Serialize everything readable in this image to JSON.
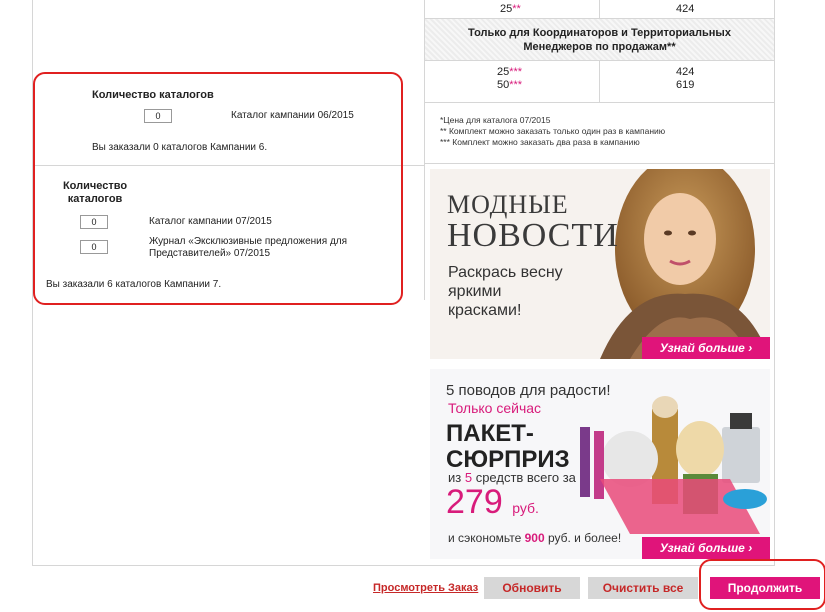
{
  "left_panel": {
    "section1": {
      "heading": "Количество каталогов",
      "qty_value": "0",
      "catalog_label": "Каталог кампании 06/2015",
      "ordered_text": "Вы заказали 0 каталогов Кампании 6."
    },
    "section2": {
      "heading_line1": "Количество",
      "heading_line2": "каталогов",
      "items": [
        {
          "qty": "0",
          "label": "Каталог кампании 07/2015"
        },
        {
          "qty": "0",
          "label_line1": "Журнал «Эксклюзивные предложения для",
          "label_line2": "Представителей» 07/2015"
        }
      ],
      "ordered_text": "Вы заказали 6 каталогов Кампании 7."
    }
  },
  "price_table": {
    "row_top": {
      "qty": "25",
      "stars": "**",
      "price": "424"
    },
    "coordinators_header_line1": "Только для Координаторов и Территориальных",
    "coordinators_header_line2": "Менеджеров по продажам**",
    "rows": [
      {
        "qty": "25",
        "stars": "***",
        "price": "424"
      },
      {
        "qty": "50",
        "stars": "***",
        "price": "619"
      }
    ],
    "notes": [
      "*Цена для каталога 07/2015",
      "** Комплект можно заказать только один раз в кампанию",
      "*** Комплект можно заказать два раза в кампанию"
    ]
  },
  "banner1": {
    "title_line1": "МОДНЫЕ",
    "title_line2": "НОВОСТИ",
    "text_line1": "Раскрась весну",
    "text_line2": "яркими",
    "text_line3": "красками!",
    "cta": "Узнай больше"
  },
  "banner2": {
    "line1": "5 поводов для радости!",
    "line2": "Только сейчас",
    "title_line1": "ПАКЕТ-",
    "title_line2": "СЮРПРИЗ",
    "sub_pre": "из ",
    "sub_num": "5",
    "sub_post": " средств всего за",
    "price": "279",
    "currency": "руб.",
    "save_pre": "и сэкономьте ",
    "save_num": "900",
    "save_post": " руб. и более!",
    "cta": "Узнай больше"
  },
  "actions": {
    "view_order": "Просмотреть Заказ",
    "update": "Обновить",
    "clear_all": "Очистить все",
    "continue": "Продолжить"
  },
  "colors": {
    "accent": "#d81b7b",
    "highlight": "#e02020"
  }
}
